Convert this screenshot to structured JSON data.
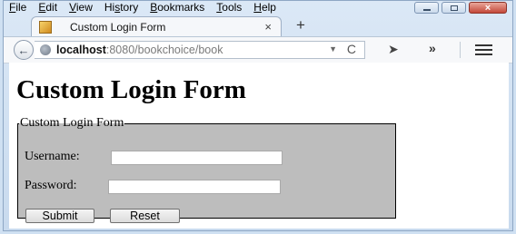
{
  "menubar": {
    "items": [
      {
        "label": "File",
        "key": "F",
        "rest": "ile"
      },
      {
        "label": "Edit",
        "key": "E",
        "rest": "dit"
      },
      {
        "label": "View",
        "key": "V",
        "rest": "iew"
      },
      {
        "label": "History",
        "key": "",
        "rest": "Hi"
      },
      {
        "label": "Bookmarks",
        "key": "B",
        "rest": "ookmarks"
      },
      {
        "label": "Tools",
        "key": "T",
        "rest": "ools"
      },
      {
        "label": "Help",
        "key": "H",
        "rest": "elp"
      }
    ],
    "history_tail": "s",
    "history_key": "s",
    "history_end": "tory"
  },
  "tab": {
    "title": "Custom Login Form",
    "close": "×",
    "new_tab": "+"
  },
  "navbar": {
    "url_host": "localhost",
    "url_rest": ":8080/bookchoice/book",
    "back": "←",
    "dropdown": "▼",
    "reload": "C",
    "send": "➤",
    "overflow": "»"
  },
  "page": {
    "heading": "Custom Login Form",
    "legend": "Custom Login Form",
    "username_label": "Username:",
    "username_value": "",
    "password_label": "Password:",
    "password_value": "",
    "submit_label": "Submit",
    "reset_label": "Reset"
  },
  "icons": {
    "tab_favicon": "page-icon",
    "globe": "globe-icon",
    "menu": "hamburger-menu-icon"
  }
}
